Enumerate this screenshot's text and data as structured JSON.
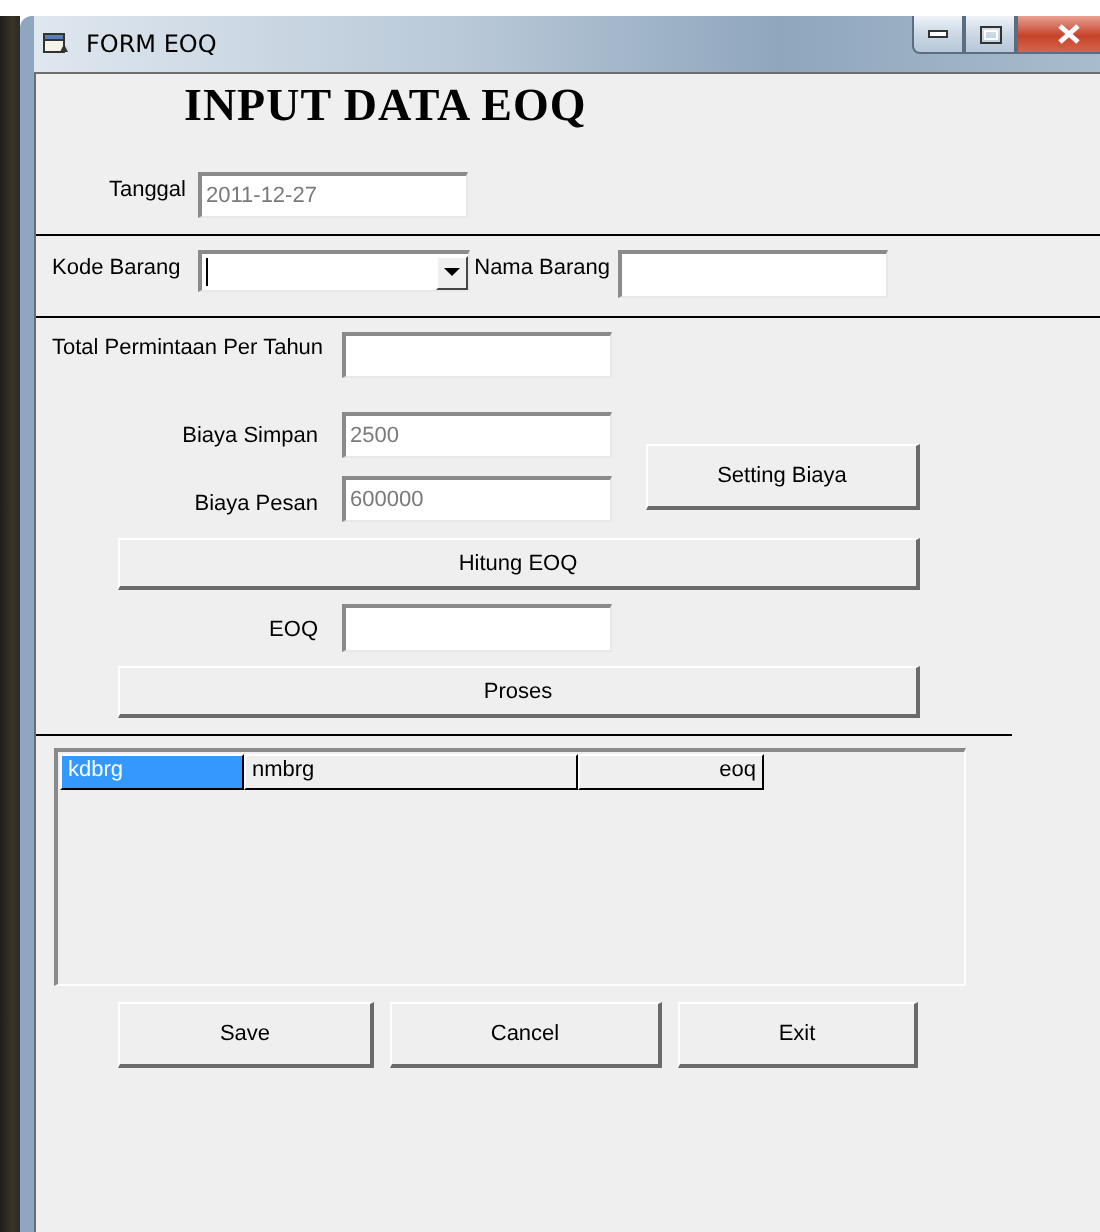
{
  "window": {
    "title": "FORM EOQ"
  },
  "heading": "INPUT DATA EOQ",
  "tanggal": {
    "label": "Tanggal",
    "value": "2011-12-27",
    "disabled": true
  },
  "kode_barang": {
    "label": "Kode Barang",
    "focused": true
  },
  "nama_barang": {
    "label": "Nama Barang"
  },
  "total_permintaan": {
    "label": "Total Permintaan Per Tahun"
  },
  "biaya_simpan": {
    "label": "Biaya Simpan",
    "value": "2500",
    "disabled": true
  },
  "biaya_pesan": {
    "label": "Biaya Pesan",
    "value": "600000",
    "disabled": true
  },
  "setting_button": {
    "label": "Setting Biaya"
  },
  "hitung_button": {
    "label": "Hitung EOQ"
  },
  "eoq": {
    "label": "EOQ"
  },
  "proses_button": {
    "label": "Proses"
  },
  "grid": {
    "columns": [
      {
        "label": "kdbrg",
        "selected": true,
        "kind": "text"
      },
      {
        "label": "nmbrg",
        "selected": false,
        "kind": "text"
      },
      {
        "label": "eoq",
        "selected": false,
        "kind": "number"
      }
    ]
  },
  "buttons": [
    {
      "label": "Save"
    },
    {
      "label": "Cancel"
    },
    {
      "label": "Exit"
    }
  ]
}
